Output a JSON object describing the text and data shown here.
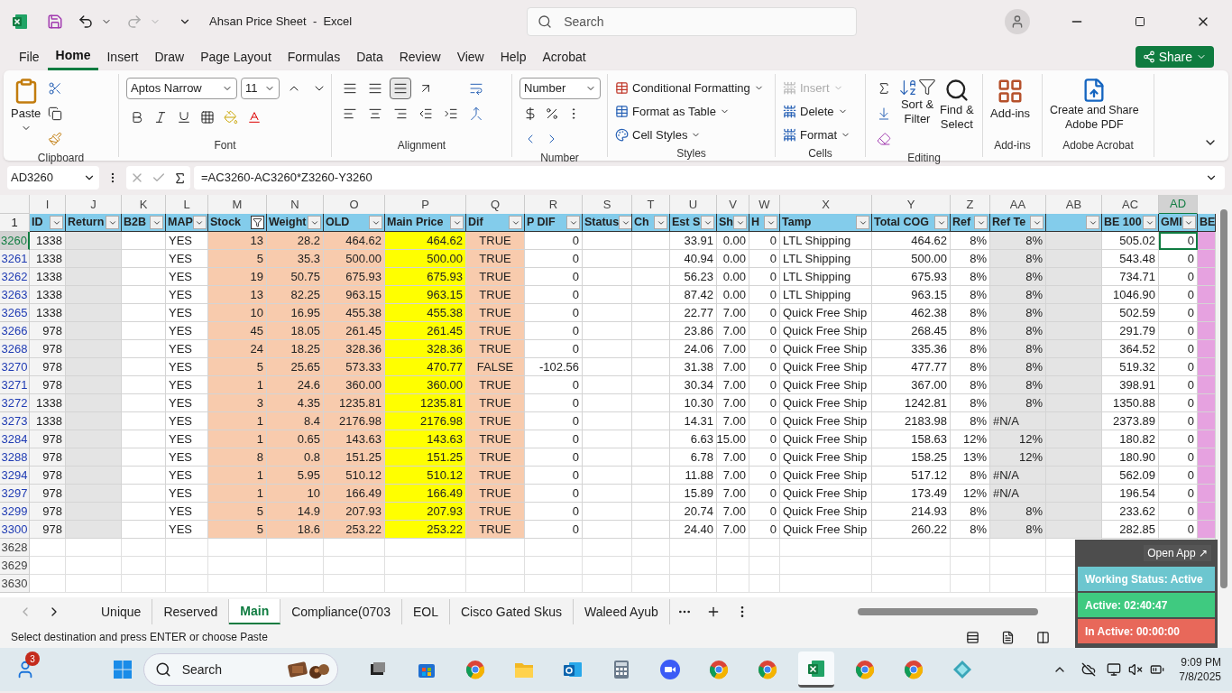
{
  "title_bar": {
    "title": "Ahsan Price Sheet  -  Excel",
    "search": {
      "placeholder": "Search"
    }
  },
  "menu_tabs": [
    {
      "label": "File",
      "selected": false
    },
    {
      "label": "Home",
      "selected": true
    },
    {
      "label": "Insert",
      "selected": false
    },
    {
      "label": "Draw",
      "selected": false
    },
    {
      "label": "Page Layout",
      "selected": false
    },
    {
      "label": "Formulas",
      "selected": false
    },
    {
      "label": "Data",
      "selected": false
    },
    {
      "label": "Review",
      "selected": false
    },
    {
      "label": "View",
      "selected": false
    },
    {
      "label": "Help",
      "selected": false
    },
    {
      "label": "Acrobat",
      "selected": false
    }
  ],
  "share_button": "Share",
  "ribbon": {
    "clipboard": {
      "paste": "Paste",
      "label": "Clipboard"
    },
    "font": {
      "name": "Aptos Narrow",
      "size": "11",
      "label": "Font"
    },
    "alignment": {
      "label": "Alignment"
    },
    "number": {
      "format": "Number",
      "label": "Number"
    },
    "styles": {
      "items": [
        "Conditional Formatting",
        "Format as Table",
        "Cell Styles"
      ],
      "label": "Styles"
    },
    "cells": {
      "items": [
        {
          "label": "Insert",
          "disabled": true
        },
        {
          "label": "Delete",
          "disabled": false
        },
        {
          "label": "Format",
          "disabled": false
        }
      ],
      "label": "Cells"
    },
    "editing": {
      "sort": [
        "Sort &",
        "Filter"
      ],
      "find": [
        "Find &",
        "Select"
      ],
      "label": "Editing"
    },
    "addins": {
      "button": "Add-ins",
      "label": "Add-ins"
    },
    "acrobat": {
      "button": [
        "Create and Share",
        "Adobe PDF"
      ],
      "label": "Adobe Acrobat"
    }
  },
  "formula_bar": {
    "name_box": "AD3260",
    "formula": "=AC3260-AC3260*Z3260-Y3260"
  },
  "sheet": {
    "columns": [
      {
        "letter": "I",
        "header": "ID",
        "filtered": false,
        "selected": false
      },
      {
        "letter": "J",
        "header": "Return",
        "filtered": false,
        "selected": false
      },
      {
        "letter": "K",
        "header": "B2B",
        "filtered": false,
        "selected": false
      },
      {
        "letter": "L",
        "header": "MAP",
        "filtered": false,
        "selected": false
      },
      {
        "letter": "M",
        "header": "Stock",
        "filtered": true,
        "selected": false
      },
      {
        "letter": "N",
        "header": "Weight",
        "filtered": false,
        "selected": false
      },
      {
        "letter": "O",
        "header": "OLD",
        "filtered": false,
        "selected": false
      },
      {
        "letter": "P",
        "header": "Main Price",
        "filtered": false,
        "selected": false
      },
      {
        "letter": "Q",
        "header": "Dif",
        "filtered": false,
        "selected": false
      },
      {
        "letter": "R",
        "header": "P DIF",
        "filtered": false,
        "selected": false
      },
      {
        "letter": "S",
        "header": "Status",
        "filtered": false,
        "selected": false
      },
      {
        "letter": "T",
        "header": "Ch",
        "filtered": false,
        "selected": false
      },
      {
        "letter": "U",
        "header": "Est S",
        "filtered": false,
        "selected": false
      },
      {
        "letter": "V",
        "header": "Sh",
        "filtered": false,
        "selected": false
      },
      {
        "letter": "W",
        "header": "H",
        "filtered": false,
        "selected": false
      },
      {
        "letter": "X",
        "header": "Tamp",
        "filtered": false,
        "selected": false
      },
      {
        "letter": "Y",
        "header": "Total COG",
        "filtered": false,
        "selected": false
      },
      {
        "letter": "Z",
        "header": "Ref",
        "filtered": false,
        "selected": false
      },
      {
        "letter": "AA",
        "header": "Ref Te",
        "filtered": false,
        "selected": false
      },
      {
        "letter": "AB",
        "filtered": false,
        "selected": false
      },
      {
        "letter": "AC",
        "header": "BE 100",
        "filtered": false,
        "selected": false
      },
      {
        "letter": "AD",
        "header": "GMI",
        "filtered": false,
        "selected": true
      },
      {
        "header": "BE"
      }
    ],
    "header_row": "1",
    "rows": [
      {
        "number": "3260",
        "selected": true,
        "cells": [
          "1338",
          null,
          null,
          "YES",
          "13",
          "28.2",
          "464.62",
          "464.62",
          "TRUE",
          "0",
          null,
          null,
          "33.91",
          "0.00",
          "0",
          "LTL Shipping",
          "464.62",
          "8%",
          "8%",
          null,
          "505.02",
          "0",
          null
        ]
      },
      {
        "number": "3261",
        "selected": false,
        "cells": [
          "1338",
          null,
          null,
          "YES",
          "5",
          "35.3",
          "500.00",
          "500.00",
          "TRUE",
          "0",
          null,
          null,
          "40.94",
          "0.00",
          "0",
          "LTL Shipping",
          "500.00",
          "8%",
          "8%",
          null,
          "543.48",
          "0",
          null
        ]
      },
      {
        "number": "3262",
        "selected": false,
        "cells": [
          "1338",
          null,
          null,
          "YES",
          "19",
          "50.75",
          "675.93",
          "675.93",
          "TRUE",
          "0",
          null,
          null,
          "56.23",
          "0.00",
          "0",
          "LTL Shipping",
          "675.93",
          "8%",
          "8%",
          null,
          "734.71",
          "0",
          null
        ]
      },
      {
        "number": "3263",
        "selected": false,
        "cells": [
          "1338",
          null,
          null,
          "YES",
          "13",
          "82.25",
          "963.15",
          "963.15",
          "TRUE",
          "0",
          null,
          null,
          "87.42",
          "0.00",
          "0",
          "LTL Shipping",
          "963.15",
          "8%",
          "8%",
          null,
          "1046.90",
          "0",
          null
        ]
      },
      {
        "number": "3265",
        "selected": false,
        "cells": [
          "1338",
          null,
          null,
          "YES",
          "10",
          "16.95",
          "455.38",
          "455.38",
          "TRUE",
          "0",
          null,
          null,
          "22.77",
          "7.00",
          "0",
          "Quick Free Ship",
          "462.38",
          "8%",
          "8%",
          null,
          "502.59",
          "0",
          null
        ]
      },
      {
        "number": "3266",
        "selected": false,
        "cells": [
          "978",
          null,
          null,
          "YES",
          "45",
          "18.05",
          "261.45",
          "261.45",
          "TRUE",
          "0",
          null,
          null,
          "23.86",
          "7.00",
          "0",
          "Quick Free Ship",
          "268.45",
          "8%",
          "8%",
          null,
          "291.79",
          "0",
          null
        ]
      },
      {
        "number": "3268",
        "selected": false,
        "cells": [
          "978",
          null,
          null,
          "YES",
          "24",
          "18.25",
          "328.36",
          "328.36",
          "TRUE",
          "0",
          null,
          null,
          "24.06",
          "7.00",
          "0",
          "Quick Free Ship",
          "335.36",
          "8%",
          "8%",
          null,
          "364.52",
          "0",
          null
        ]
      },
      {
        "number": "3270",
        "selected": false,
        "cells": [
          "978",
          null,
          null,
          "YES",
          "5",
          "25.65",
          "573.33",
          "470.77",
          "FALSE",
          "-102.56",
          null,
          null,
          "31.38",
          "7.00",
          "0",
          "Quick Free Ship",
          "477.77",
          "8%",
          "8%",
          null,
          "519.32",
          "0",
          null
        ]
      },
      {
        "number": "3271",
        "selected": false,
        "cells": [
          "978",
          null,
          null,
          "YES",
          "1",
          "24.6",
          "360.00",
          "360.00",
          "TRUE",
          "0",
          null,
          null,
          "30.34",
          "7.00",
          "0",
          "Quick Free Ship",
          "367.00",
          "8%",
          "8%",
          null,
          "398.91",
          "0",
          null
        ]
      },
      {
        "number": "3272",
        "selected": false,
        "cells": [
          "1338",
          null,
          null,
          "YES",
          "3",
          "4.35",
          "1235.81",
          "1235.81",
          "TRUE",
          "0",
          null,
          null,
          "10.30",
          "7.00",
          "0",
          "Quick Free Ship",
          "1242.81",
          "8%",
          "8%",
          null,
          "1350.88",
          "0",
          null
        ]
      },
      {
        "number": "3273",
        "selected": false,
        "cells": [
          "1338",
          null,
          null,
          "YES",
          "1",
          "8.4",
          "2176.98",
          "2176.98",
          "TRUE",
          "0",
          null,
          null,
          "14.31",
          "7.00",
          "0",
          "Quick Free Ship",
          "2183.98",
          "8%",
          {
            "text": "#N/A",
            "kind": "error"
          },
          null,
          "2373.89",
          "0",
          null
        ]
      },
      {
        "number": "3284",
        "selected": false,
        "cells": [
          "978",
          null,
          null,
          "YES",
          "1",
          "0.65",
          "143.63",
          "143.63",
          "TRUE",
          "0",
          null,
          null,
          "6.63",
          "15.00",
          "0",
          "Quick Free Ship",
          "158.63",
          "12%",
          "12%",
          null,
          "180.82",
          "0",
          null
        ]
      },
      {
        "number": "3288",
        "selected": false,
        "cells": [
          "978",
          null,
          null,
          "YES",
          "8",
          "0.8",
          "151.25",
          "151.25",
          "TRUE",
          "0",
          null,
          null,
          "6.78",
          "7.00",
          "0",
          "Quick Free Ship",
          "158.25",
          "13%",
          "12%",
          null,
          "180.90",
          "0",
          null
        ]
      },
      {
        "number": "3294",
        "selected": false,
        "cells": [
          "978",
          null,
          null,
          "YES",
          "1",
          "5.95",
          "510.12",
          "510.12",
          "TRUE",
          "0",
          null,
          null,
          "11.88",
          "7.00",
          "0",
          "Quick Free Ship",
          "517.12",
          "8%",
          {
            "text": "#N/A",
            "kind": "error"
          },
          null,
          "562.09",
          "0",
          null
        ]
      },
      {
        "number": "3297",
        "selected": false,
        "cells": [
          "978",
          null,
          null,
          "YES",
          "1",
          "10",
          "166.49",
          "166.49",
          "TRUE",
          "0",
          null,
          null,
          "15.89",
          "7.00",
          "0",
          "Quick Free Ship",
          "173.49",
          "12%",
          {
            "text": "#N/A",
            "kind": "error"
          },
          null,
          "196.54",
          "0",
          null
        ]
      },
      {
        "number": "3299",
        "selected": false,
        "cells": [
          "978",
          null,
          null,
          "YES",
          "5",
          "14.9",
          "207.93",
          "207.93",
          "TRUE",
          "0",
          null,
          null,
          "20.74",
          "7.00",
          "0",
          "Quick Free Ship",
          "214.93",
          "8%",
          "8%",
          null,
          "233.62",
          "0",
          null
        ]
      },
      {
        "number": "3300",
        "selected": false,
        "cells": [
          "978",
          null,
          null,
          "YES",
          "5",
          "18.6",
          "253.22",
          "253.22",
          "TRUE",
          "0",
          null,
          null,
          "24.40",
          "7.00",
          "0",
          "Quick Free Ship",
          "260.22",
          "8%",
          "8%",
          null,
          "282.85",
          "0",
          null
        ]
      }
    ],
    "empty_rows": [
      "3628",
      "3629",
      "3630"
    ]
  },
  "sheet_tabs": [
    {
      "label": "Unique",
      "selected": false
    },
    {
      "label": "Reserved",
      "selected": false
    },
    {
      "label": "Main",
      "selected": true
    },
    {
      "label": "Compliance(0703",
      "selected": false
    },
    {
      "label": "EOL",
      "selected": false
    },
    {
      "label": "Cisco Gated Skus",
      "selected": false
    },
    {
      "label": "Waleed Ayub",
      "selected": false
    }
  ],
  "status_bar": {
    "message": "Select destination and press ENTER or choose Paste"
  },
  "tracker": {
    "open": "Open App ↗",
    "status": "Working Status: Active",
    "active": "Active: 02:40:47",
    "inactive": "In Active: 00:00:00"
  },
  "taskbar": {
    "badge": "3",
    "search": "Search",
    "time": "9:09 PM",
    "date": "7/8/2025",
    "apps": [
      {
        "kind": "taskview",
        "selected": false
      },
      {
        "kind": "store",
        "selected": false
      },
      {
        "kind": "browser",
        "selected": false
      },
      {
        "kind": "folder",
        "selected": false
      },
      {
        "kind": "mail",
        "selected": false
      },
      {
        "kind": "calculator",
        "selected": false
      },
      {
        "kind": "video",
        "selected": false
      },
      {
        "kind": "browser",
        "selected": false
      },
      {
        "kind": "browser",
        "selected": false
      },
      {
        "kind": "excel",
        "selected": true
      },
      {
        "kind": "browser",
        "selected": false
      },
      {
        "kind": "browser",
        "selected": false
      },
      {
        "kind": "diamond",
        "selected": false
      }
    ]
  }
}
